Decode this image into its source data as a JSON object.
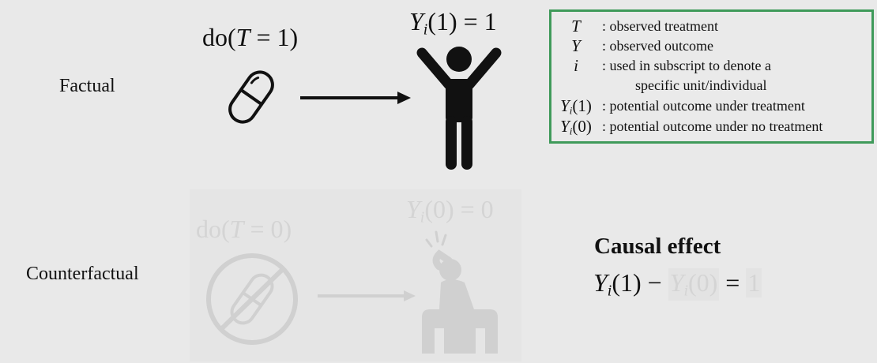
{
  "rows": {
    "factual_label": "Factual",
    "counterfactual_label": "Counterfactual"
  },
  "factual": {
    "do_prefix": "do(",
    "do_var": "T",
    "do_rest": " = 1)",
    "outcome_var": "Y",
    "outcome_sub": "i",
    "outcome_rest": "(1) = 1",
    "pill_icon": "pill-icon",
    "person_icon": "person-arms-raised-icon",
    "arrow_icon": "arrow-right-icon"
  },
  "counterfactual": {
    "do_prefix": "do(",
    "do_var": "T",
    "do_rest": " = 0)",
    "outcome_var": "Y",
    "outcome_sub": "i",
    "outcome_rest": "(0) = 0",
    "pill_icon": "no-pill-icon",
    "person_icon": "sick-person-icon",
    "arrow_icon": "arrow-right-icon"
  },
  "legend": {
    "border_color": "#3f9a5a",
    "items": [
      {
        "sym_var": "T",
        "sym_sub": "",
        "sym_rest": "",
        "desc": ": observed treatment"
      },
      {
        "sym_var": "Y",
        "sym_sub": "",
        "sym_rest": "",
        "desc": ": observed outcome"
      },
      {
        "sym_var": "i",
        "sym_sub": "",
        "sym_rest": "",
        "desc": ": used in subscript to denote a"
      },
      {
        "sym_var": "",
        "sym_sub": "",
        "sym_rest": "",
        "desc": "specific unit/individual"
      },
      {
        "sym_var": "Y",
        "sym_sub": "i",
        "sym_rest": "(1)",
        "desc": ": potential outcome under treatment"
      },
      {
        "sym_var": "Y",
        "sym_sub": "i",
        "sym_rest": "(0)",
        "desc": ": potential outcome under no treatment"
      }
    ]
  },
  "causal": {
    "title": "Causal effect",
    "y1_var": "Y",
    "y1_sub": "i",
    "y1_rest": "(1) −",
    "y0_var": "Y",
    "y0_sub": "i",
    "y0_rest": "(0)",
    "equals": "=",
    "value": "1"
  }
}
